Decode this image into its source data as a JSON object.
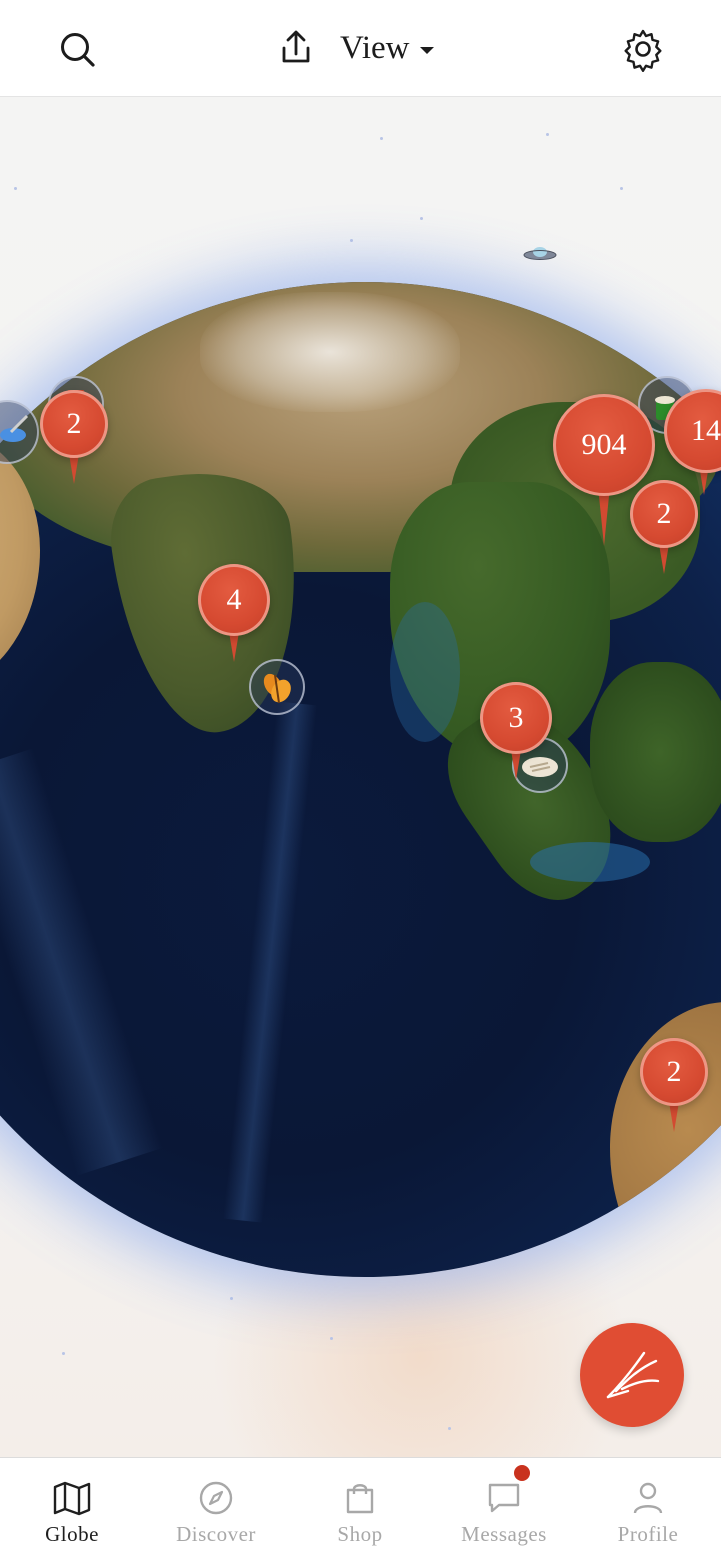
{
  "header": {
    "view_label": "View",
    "icons": [
      "search-icon",
      "share-icon",
      "settings-icon"
    ]
  },
  "map": {
    "clusters": [
      {
        "count": "2"
      },
      {
        "count": "904"
      },
      {
        "count": "14"
      },
      {
        "count": "2"
      },
      {
        "count": "4"
      },
      {
        "count": "3"
      },
      {
        "count": "2"
      }
    ]
  },
  "fab": {
    "icon": "quill-pen-icon"
  },
  "nav": {
    "items": [
      {
        "label": "Globe",
        "icon": "map-icon",
        "active": true
      },
      {
        "label": "Discover",
        "icon": "compass-icon",
        "active": false
      },
      {
        "label": "Shop",
        "icon": "shopping-bag-icon",
        "active": false
      },
      {
        "label": "Messages",
        "icon": "chat-icon",
        "active": false,
        "has_notification": true
      },
      {
        "label": "Profile",
        "icon": "user-icon",
        "active": false
      }
    ]
  },
  "colors": {
    "accent": "#e04d33",
    "active_nav": "#1f1f1f",
    "inactive_nav": "#a8a8a8",
    "notification": "#c9321e"
  }
}
